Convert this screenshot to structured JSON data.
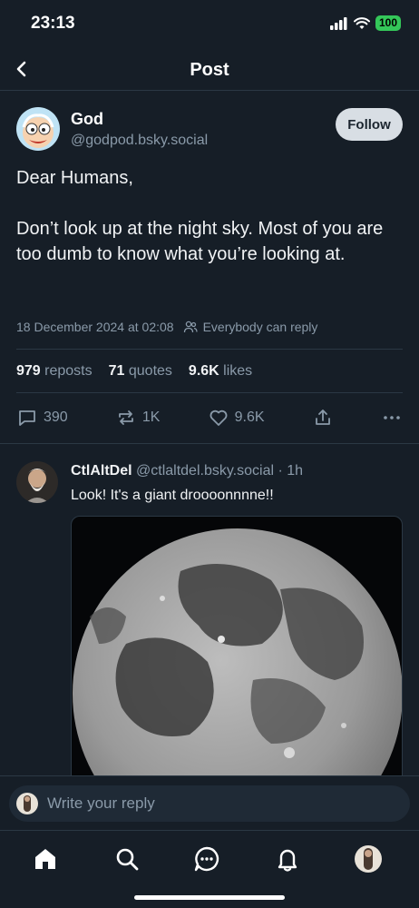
{
  "status_bar": {
    "time": "23:13",
    "battery": "100"
  },
  "nav": {
    "title": "Post"
  },
  "post": {
    "author_name": "God",
    "author_handle": "@godpod.bsky.social",
    "follow_label": "Follow",
    "text": "Dear Humans,\n\nDon’t look up at the night sky. Most of you are too dumb to know what you’re looking at.",
    "timestamp": "18 December 2024 at 02:08",
    "reply_setting": "Everybody can reply",
    "stats": {
      "reposts_count": "979",
      "reposts_label": "reposts",
      "quotes_count": "71",
      "quotes_label": "quotes",
      "likes_count": "9.6K",
      "likes_label": "likes"
    },
    "actions": {
      "replies": "390",
      "reposts": "1K",
      "likes": "9.6K"
    }
  },
  "reply": {
    "author_name": "CtlAltDel",
    "author_handle": "@ctlaltdel.bsky.social",
    "time": "· 1h",
    "text": "Look! It's a giant droooonnnne!!"
  },
  "composer": {
    "placeholder": "Write your reply"
  },
  "tabs": [
    "home",
    "search",
    "chat",
    "notifications",
    "profile"
  ],
  "colors": {
    "background": "#161e27",
    "muted": "#8a9aa9",
    "follow_bg": "#d8dee4",
    "battery": "#34c759"
  }
}
